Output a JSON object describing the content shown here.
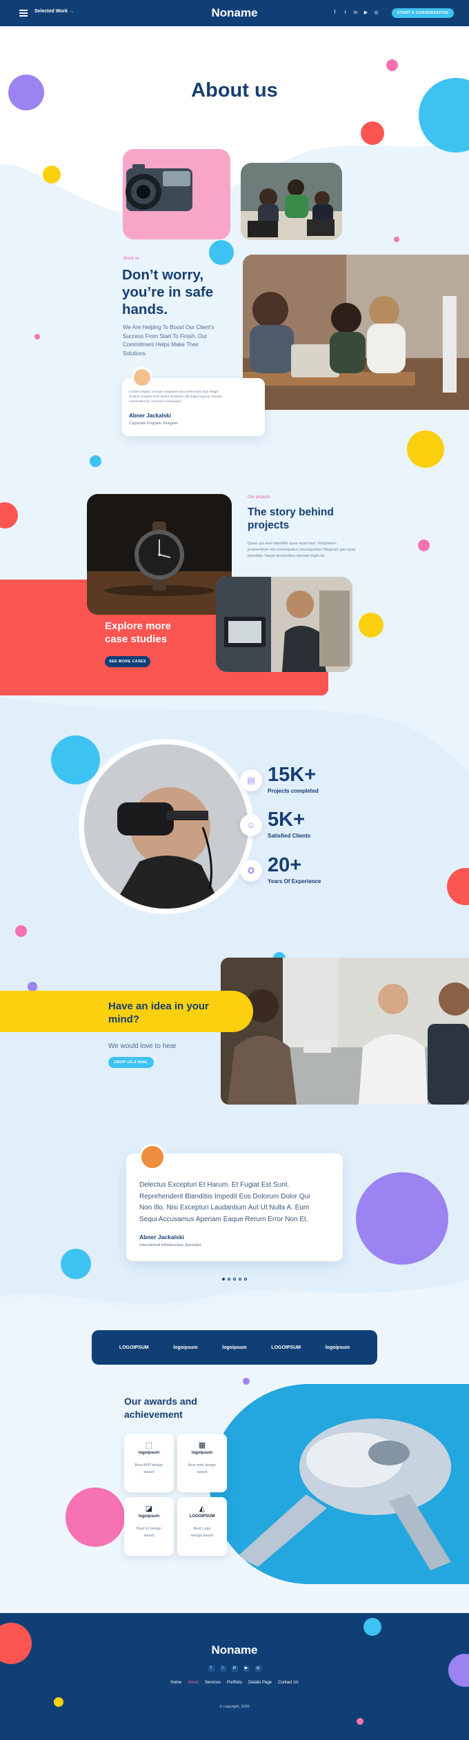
{
  "header": {
    "selected_work": "Selected Work",
    "selected_work_arrow": "→",
    "logo": "Noname",
    "socials": [
      "f",
      "t",
      "in",
      "▶",
      "◎"
    ],
    "cta": "START A CONVERSATION"
  },
  "hero": {
    "title": "About us"
  },
  "safe": {
    "kicker": "About us",
    "title_l1": "Don’t worry,",
    "title_l2": "you’re in safe",
    "title_l3": "hands.",
    "desc_l1": "We Are Helping To Boost Our Client’s",
    "desc_l2": "Success From Start To Finish. Our",
    "desc_l3": "Commitment Helps Make Their",
    "desc_l4": "Solutions.",
    "quote_l1": "Incidunt aliquid, cumque voluptatem ipsa perferendis fuga. Magni",
    "quote_l2": "incidunt voluptas enim facere architecto odio fugiat fuga ea. Eveniet",
    "quote_l3": "consectetur hic commodi consequatur.",
    "author": "Abner Jackalski",
    "role": "Corporate Program Designer"
  },
  "story": {
    "kicker": "Our projects",
    "title_l1": "The story behind",
    "title_l2": "projects",
    "desc_l1": "Quam qui eum blanditiis quas modi nam. Voluptatum",
    "desc_l2": "praesentium eos consequatur consequuntur. Magnam quis quas",
    "desc_l3": "blanditiis. Saepe temporibus aperiam fugit est.",
    "explore_l1": "Explore more",
    "explore_l2": "case studies",
    "button": "SEE MORE CASES"
  },
  "stats": [
    {
      "value": "15K+",
      "label": "Projects completed",
      "icon": "document-icon"
    },
    {
      "value": "5K+",
      "label": "Satisfied Clients",
      "icon": "users-icon"
    },
    {
      "value": "20+",
      "label": "Years Of Experience",
      "icon": "award-icon"
    }
  ],
  "idea": {
    "title_l1": "Have an idea in your",
    "title_l2": "mind?",
    "subtitle": "We would love to hear",
    "button": "DROP US A MAIL"
  },
  "testimonial": {
    "text_l1": "Delectus Excepturi Et Harum. Et Fugiat Est Sunt.",
    "text_l2": "Reprehenderit Blanditiis Impedit Eos Dolorum Dolor Qui",
    "text_l3": "Non Illo. Nisi Excepturi Laudantium Aut Ut Nulla A. Eum",
    "text_l4": "Sequi Accusamus Aperiam Eaque Rerum Error Non Et.",
    "author": "Abner Jackalski",
    "role": "International Infrastructure Specialist"
  },
  "logos": [
    "LOGOIPSUM",
    "logoipsum",
    "logoipsum",
    "LOGOIPSUM",
    "logoipsum"
  ],
  "awards": {
    "title_l1": "Our awards and",
    "title_l2": "achievement",
    "items": [
      {
        "logo": "logoipsum",
        "text_l1": "Best APP design",
        "text_l2": "award"
      },
      {
        "logo": "logoipsum",
        "text_l1": "Best web design",
        "text_l2": "award"
      },
      {
        "logo": "logoipsum",
        "text_l1": "Best UI design",
        "text_l2": "award"
      },
      {
        "logo": "LOGOIPSUM",
        "text_l1": "Best Logo",
        "text_l2": "design award"
      }
    ]
  },
  "footer": {
    "logo": "Noname",
    "socials": [
      "f",
      "t",
      "in",
      "▶",
      "◎"
    ],
    "nav": [
      "Home",
      "About",
      "Services",
      "Portfolio",
      "Details Page",
      "Contact Us"
    ],
    "copyright": "© copyright, 2020"
  },
  "colors": {
    "navy": "#103f76",
    "cyan": "#3ec2f2",
    "coral": "#fb5552",
    "yellow": "#fbd00f",
    "purple": "#9b83f2",
    "pink": "#f672b3",
    "background": "#eaf4fc"
  }
}
